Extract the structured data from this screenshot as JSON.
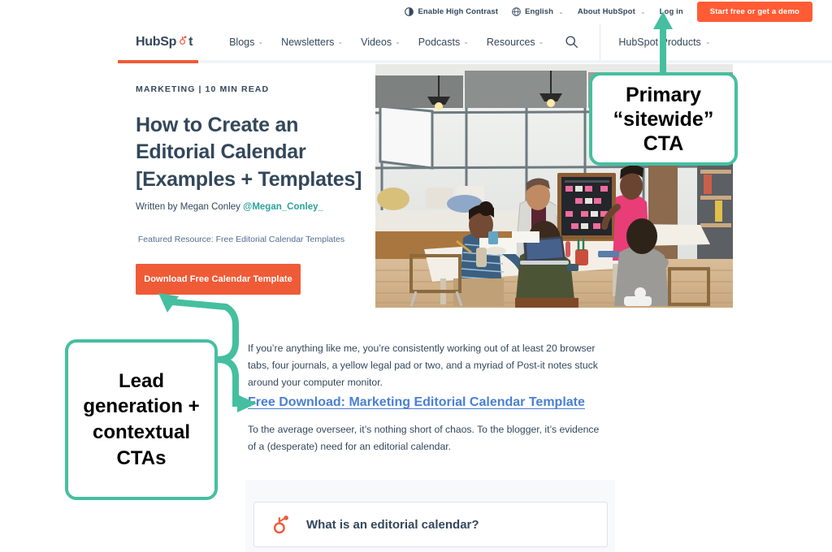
{
  "utility_bar": {
    "items": [
      {
        "label": "Enable High Contrast",
        "icon": "contrast-icon",
        "caret": ""
      },
      {
        "label": "English",
        "icon": "globe-icon",
        "caret": "⌄"
      },
      {
        "label": "About HubSpot",
        "icon": "",
        "caret": "⌄"
      },
      {
        "label": "Log in",
        "icon": "",
        "caret": ""
      }
    ],
    "cta_label": "Start free or get a demo",
    "cta_color": "#ff5c35"
  },
  "nav": {
    "logo_text": "HubSp t",
    "logo_icon": "hubspot-sprocket-icon",
    "links": [
      {
        "label": "Blogs",
        "caret": "⌄"
      },
      {
        "label": "Newsletters",
        "caret": "⌄"
      },
      {
        "label": "Videos",
        "caret": "⌄"
      },
      {
        "label": "Podcasts",
        "caret": "⌄"
      },
      {
        "label": "Resources",
        "caret": "⌄"
      }
    ],
    "search_icon": "search-icon",
    "products_label": "HubSpot Products",
    "products_caret": "⌄",
    "progress_color": "#ef5b37"
  },
  "article": {
    "kicker": "MARKETING | 10 MIN READ",
    "headline": "How to Create an Editorial Calendar [Examples + Templates]",
    "byline_prefix": "Written by Megan Conley ",
    "byline_handle": "@Megan_Conley_",
    "featured_resource_label": "Featured Resource: Free Editorial Calendar Templates",
    "featured_button_label": "Download Free Calendar Template",
    "hero_alt": "office-team-meeting-photo"
  },
  "body": {
    "paragraph_1": "If you’re anything like me, you’re consistently working out of at least 20 browser tabs, four journals, a yellow legal pad or two, and a myriad of Post-it notes stuck around your computer monitor.",
    "inline_link": "Free Download: Marketing Editorial Calendar Template",
    "paragraph_2": "To the average overseer, it’s nothing short of chaos. To the blogger, it’s evidence of a (desperate) need for an editorial calendar."
  },
  "toc": {
    "icon": "hubspot-sprocket-icon",
    "title": "What is an editorial calendar?"
  },
  "annotations": {
    "accent_color": "#45bfa0",
    "cta_note": "Primary “sitewide” CTA",
    "lead_note": "Lead generation + contextual CTAs"
  }
}
